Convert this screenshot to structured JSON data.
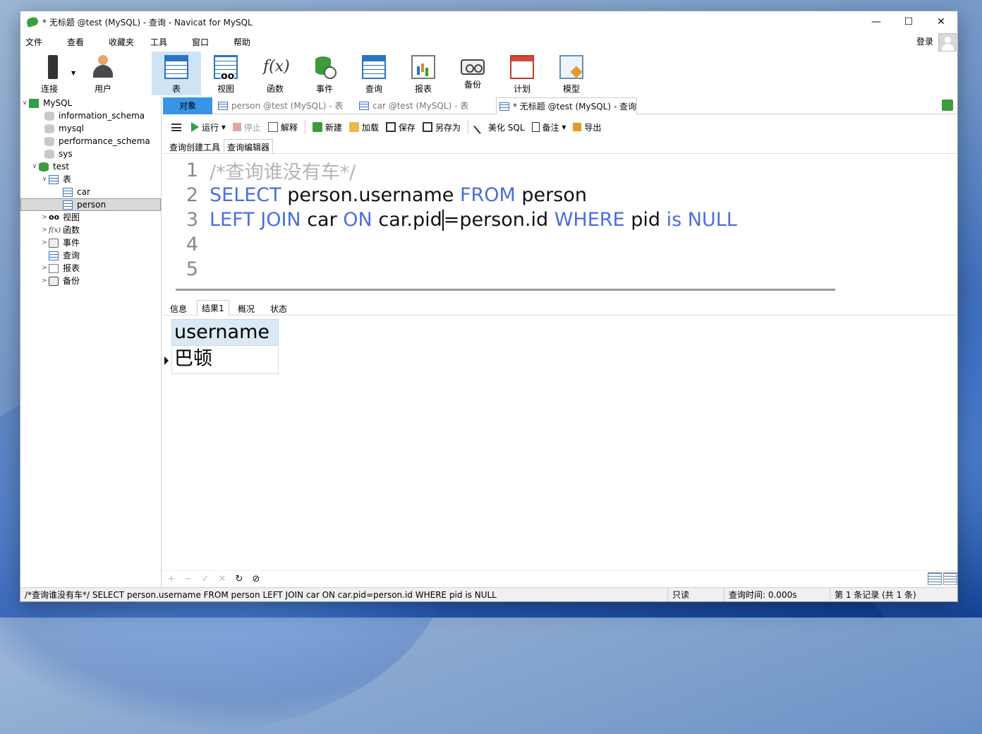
{
  "window": {
    "title": "* 无标题 @test (MySQL) - 查询 - Navicat for MySQL",
    "controls": [
      "—",
      "☐",
      "✕"
    ]
  },
  "menu": [
    "文件",
    "查看",
    "收藏夹",
    "工具",
    "窗口",
    "帮助"
  ],
  "login_label": "登录",
  "toolbar": [
    {
      "label": "连接",
      "icon": "plug-icon"
    },
    {
      "label": "用户",
      "icon": "user-icon"
    },
    {
      "label": "表",
      "icon": "table-icon"
    },
    {
      "label": "视图",
      "icon": "view-icon"
    },
    {
      "label": "函数",
      "icon": "function-icon"
    },
    {
      "label": "事件",
      "icon": "event-icon"
    },
    {
      "label": "查询",
      "icon": "query-icon"
    },
    {
      "label": "报表",
      "icon": "report-icon"
    },
    {
      "label": "备份",
      "icon": "backup-icon"
    },
    {
      "label": "计划",
      "icon": "calendar-icon"
    },
    {
      "label": "模型",
      "icon": "model-icon"
    }
  ],
  "tree": {
    "root": "MySQL",
    "databases": [
      "information_schema",
      "mysql",
      "performance_schema",
      "sys",
      "test"
    ],
    "test_children": {
      "tables_label": "表",
      "tables": [
        "car",
        "person"
      ],
      "others": [
        "视图",
        "函数",
        "事件",
        "查询",
        "报表",
        "备份"
      ]
    }
  },
  "tabs": {
    "objects": "对象",
    "items": [
      "person @test (MySQL) - 表",
      "car @test (MySQL) - 表",
      "* 无标题 @test (MySQL) - 查询"
    ]
  },
  "query_toolbar": {
    "run": "运行",
    "stop": "停止",
    "explain": "解释",
    "new": "新建",
    "load": "加载",
    "save": "保存",
    "save_as": "另存为",
    "beautify": "美化 SQL",
    "comment": "备注",
    "export": "导出"
  },
  "editor_tabs": [
    "查询创建工具",
    "查询编辑器"
  ],
  "editor": {
    "line_numbers": [
      "1",
      "2",
      "3",
      "4",
      "5"
    ],
    "line1_comment": "/*查询谁没有车*/",
    "line2": {
      "k1": "SELECT",
      "t1": "person.username",
      "k2": "FROM",
      "t2": "person"
    },
    "line3": {
      "k1": "LEFT JOIN",
      "t1": "car",
      "k2": "ON",
      "t2a": "car.pid",
      "t2b": "=person.id",
      "k3": "WHERE",
      "t3": "pid",
      "k4": "is NULL"
    }
  },
  "result_tabs": [
    "信息",
    "结果1",
    "概况",
    "状态"
  ],
  "result": {
    "columns": [
      "username"
    ],
    "rows": [
      [
        "巴顿"
      ]
    ]
  },
  "grid_footer": [
    "+",
    "−",
    "✓",
    "✕",
    "↻",
    "⊘"
  ],
  "status": {
    "sql": "/*查询谁没有车*/ SELECT person.username FROM person  LEFT JOIN car ON car.pid=person.id WHERE pid is NULL",
    "mode": "只读",
    "time": "查询时间: 0.000s",
    "records": "第 1 条记录 (共 1 条)"
  },
  "colors": {
    "accent": "#3794e6",
    "keyword": "#4a6ee0",
    "comment": "#b5b5b5",
    "header_bg": "#dbe9f7"
  }
}
